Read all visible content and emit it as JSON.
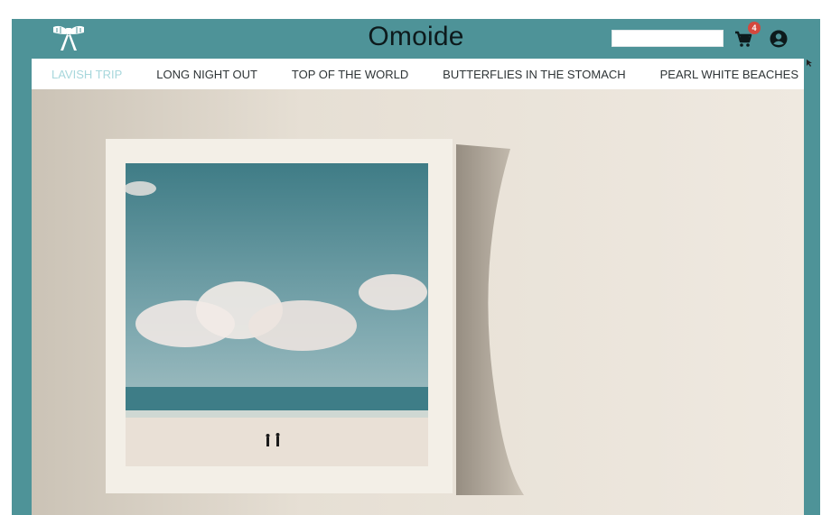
{
  "site": {
    "title": "Omoide"
  },
  "search": {
    "value": "",
    "placeholder": ""
  },
  "cart": {
    "count": "4"
  },
  "nav": {
    "items": [
      {
        "label": "LAVISH TRIP",
        "active": true
      },
      {
        "label": "LONG NIGHT OUT",
        "active": false
      },
      {
        "label": "TOP OF THE WORLD",
        "active": false
      },
      {
        "label": "BUTTERFLIES IN THE STOMACH",
        "active": false
      },
      {
        "label": "PEARL WHITE BEACHES",
        "active": false
      }
    ]
  },
  "icons": {
    "logo": "bow-logo-icon",
    "cart": "shopping-cart-icon",
    "account": "user-circle-icon"
  },
  "colors": {
    "header_bg": "#4e9398",
    "nav_active": "#a7d7dc",
    "nav_text": "#2e3436",
    "badge": "#d4483e",
    "logo": "#ffffff"
  }
}
